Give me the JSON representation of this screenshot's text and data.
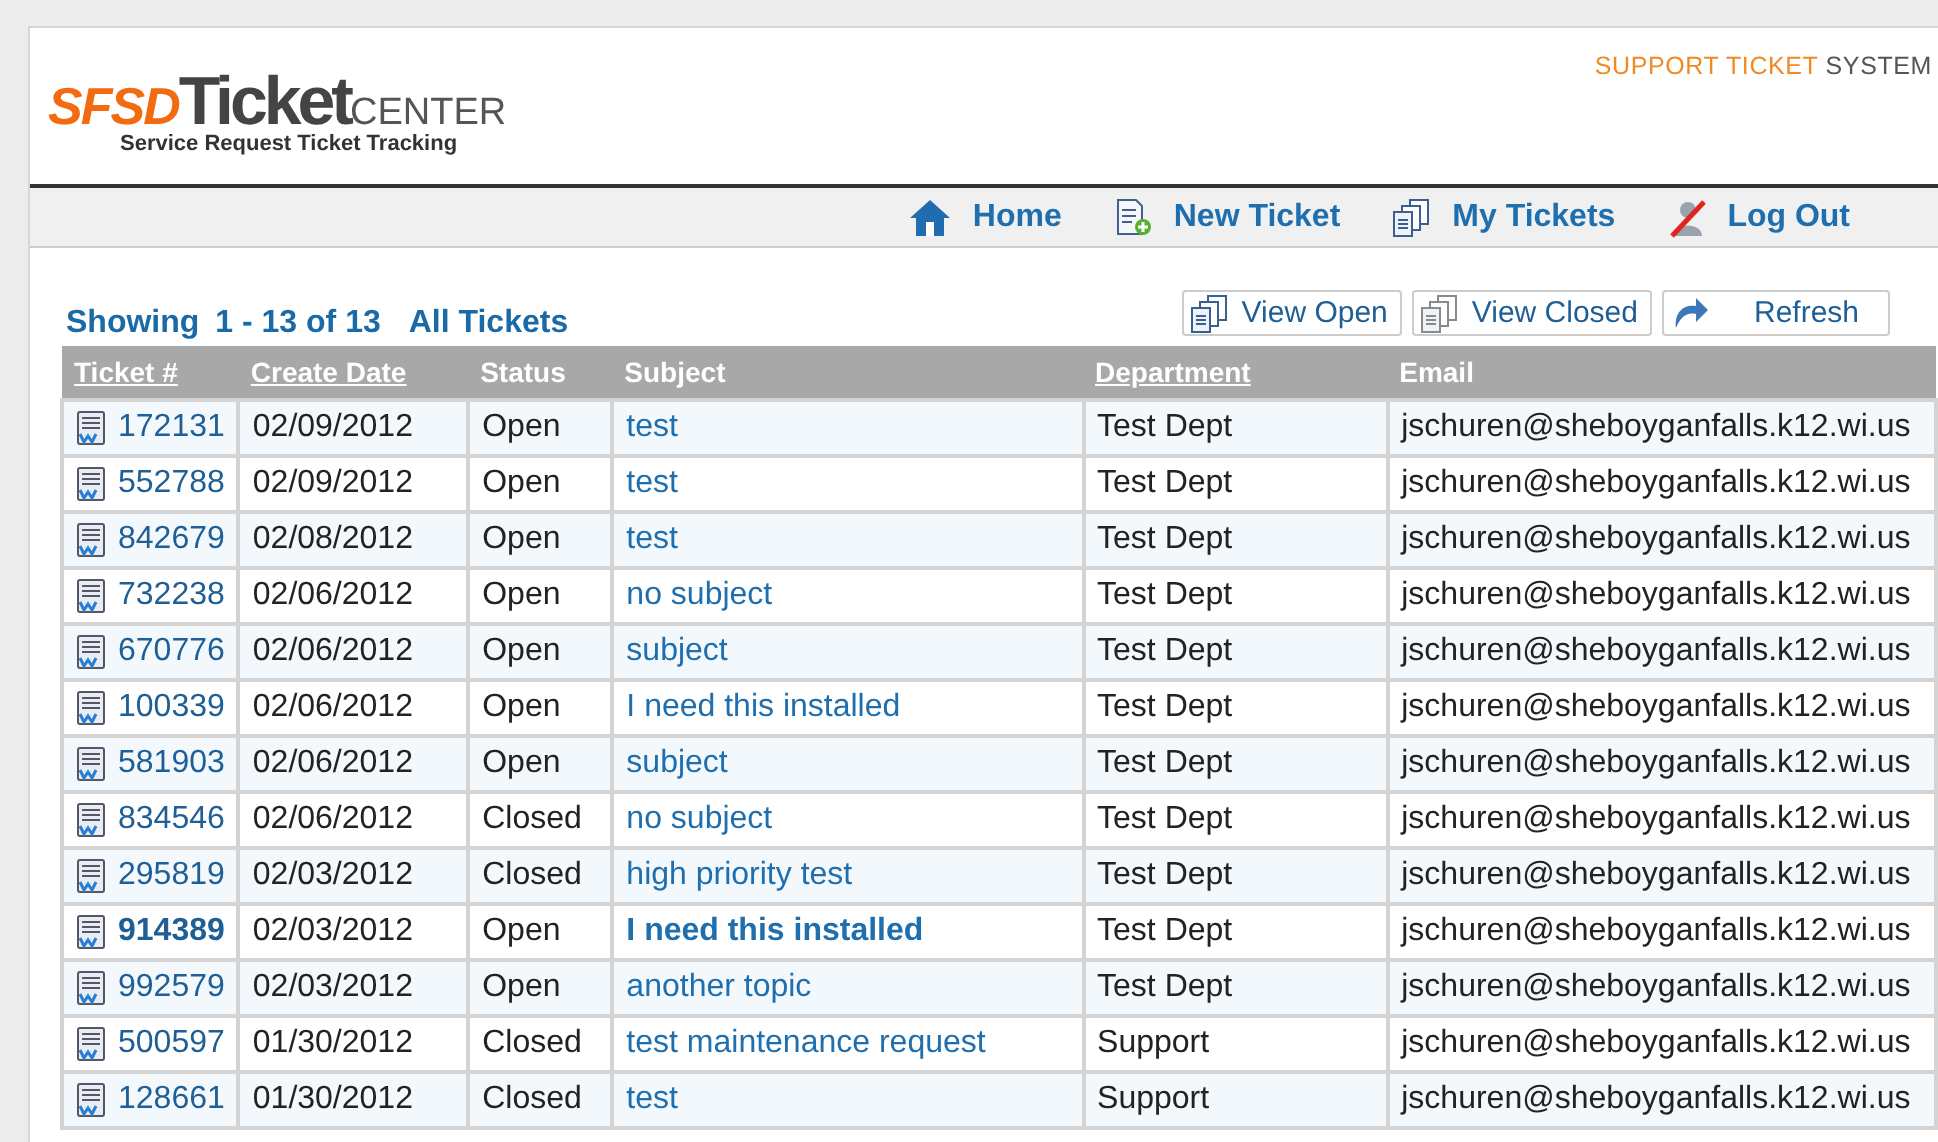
{
  "header": {
    "logo": {
      "brand": "SFSD",
      "word": "Ticket",
      "suffix": "CENTER",
      "tagline": "Service Request Ticket Tracking"
    },
    "system_label": {
      "highlight": "SUPPORT TICKET",
      "rest": "SYSTEM"
    }
  },
  "nav": [
    {
      "label": "Home",
      "kind": "home"
    },
    {
      "label": "New Ticket",
      "kind": "new"
    },
    {
      "label": "My Tickets",
      "kind": "tickets"
    },
    {
      "label": "Log Out",
      "kind": "logout"
    }
  ],
  "summary": {
    "showing": "Showing",
    "range": "1 - 13 of 13",
    "filter": "All Tickets"
  },
  "actions": [
    {
      "label": "View Open",
      "kind": "open"
    },
    {
      "label": "View Closed",
      "kind": "closed"
    },
    {
      "label": "Refresh",
      "kind": "refresh"
    }
  ],
  "table": {
    "columns": [
      {
        "label": "Ticket #",
        "sortable": true
      },
      {
        "label": "Create Date",
        "sortable": true
      },
      {
        "label": "Status",
        "sortable": false
      },
      {
        "label": "Subject",
        "sortable": false
      },
      {
        "label": "Department",
        "sortable": true
      },
      {
        "label": "Email",
        "sortable": false
      }
    ],
    "rows": [
      {
        "ticket": "172131",
        "date": "02/09/2012",
        "status": "Open",
        "subject": "test",
        "department": "Test Dept",
        "email": "jschuren@sheboyganfalls.k12.wi.us",
        "unread": false
      },
      {
        "ticket": "552788",
        "date": "02/09/2012",
        "status": "Open",
        "subject": "test",
        "department": "Test Dept",
        "email": "jschuren@sheboyganfalls.k12.wi.us",
        "unread": false
      },
      {
        "ticket": "842679",
        "date": "02/08/2012",
        "status": "Open",
        "subject": "test",
        "department": "Test Dept",
        "email": "jschuren@sheboyganfalls.k12.wi.us",
        "unread": false
      },
      {
        "ticket": "732238",
        "date": "02/06/2012",
        "status": "Open",
        "subject": "no subject",
        "department": "Test Dept",
        "email": "jschuren@sheboyganfalls.k12.wi.us",
        "unread": false
      },
      {
        "ticket": "670776",
        "date": "02/06/2012",
        "status": "Open",
        "subject": "subject",
        "department": "Test Dept",
        "email": "jschuren@sheboyganfalls.k12.wi.us",
        "unread": false
      },
      {
        "ticket": "100339",
        "date": "02/06/2012",
        "status": "Open",
        "subject": "I need this installed",
        "department": "Test Dept",
        "email": "jschuren@sheboyganfalls.k12.wi.us",
        "unread": false
      },
      {
        "ticket": "581903",
        "date": "02/06/2012",
        "status": "Open",
        "subject": "subject",
        "department": "Test Dept",
        "email": "jschuren@sheboyganfalls.k12.wi.us",
        "unread": false
      },
      {
        "ticket": "834546",
        "date": "02/06/2012",
        "status": "Closed",
        "subject": "no subject",
        "department": "Test Dept",
        "email": "jschuren@sheboyganfalls.k12.wi.us",
        "unread": false
      },
      {
        "ticket": "295819",
        "date": "02/03/2012",
        "status": "Closed",
        "subject": "high priority test",
        "department": "Test Dept",
        "email": "jschuren@sheboyganfalls.k12.wi.us",
        "unread": false
      },
      {
        "ticket": "914389",
        "date": "02/03/2012",
        "status": "Open",
        "subject": "I need this installed",
        "department": "Test Dept",
        "email": "jschuren@sheboyganfalls.k12.wi.us",
        "unread": true
      },
      {
        "ticket": "992579",
        "date": "02/03/2012",
        "status": "Open",
        "subject": "another topic",
        "department": "Test Dept",
        "email": "jschuren@sheboyganfalls.k12.wi.us",
        "unread": false
      },
      {
        "ticket": "500597",
        "date": "01/30/2012",
        "status": "Closed",
        "subject": "test maintenance request",
        "department": "Support",
        "email": "jschuren@sheboyganfalls.k12.wi.us",
        "unread": false
      },
      {
        "ticket": "128661",
        "date": "01/30/2012",
        "status": "Closed",
        "subject": "test",
        "department": "Support",
        "email": "jschuren@sheboyganfalls.k12.wi.us",
        "unread": false
      }
    ]
  }
}
